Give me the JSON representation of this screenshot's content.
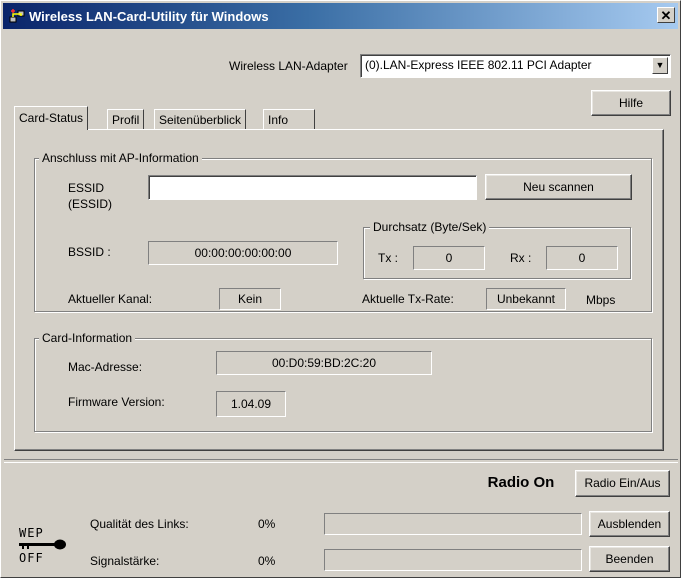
{
  "window": {
    "title": "Wireless LAN-Card-Utility für Windows",
    "close_label": "✕"
  },
  "adapter": {
    "label": "Wireless LAN-Adapter",
    "selected": "(0).LAN-Express IEEE 802.11 PCI Adapter",
    "arrow": "▼"
  },
  "help_button": "Hilfe",
  "tabs": [
    "Card-Status",
    "Profil",
    "Seitenüberblick",
    "Info"
  ],
  "ap_group": {
    "title": "Anschluss mit AP-Information",
    "essid_label": "ESSID\n(ESSID)",
    "essid_value": "",
    "rescan_button": "Neu scannen",
    "bssid_label": "BSSID :",
    "bssid_value": "00:00:00:00:00:00",
    "throughput": {
      "title": "Durchsatz (Byte/Sek)",
      "tx_label": "Tx :",
      "tx_value": "0",
      "rx_label": "Rx :",
      "rx_value": "0"
    },
    "channel_label": "Aktueller Kanal:",
    "channel_value": "Kein",
    "txrate_label": "Aktuelle Tx-Rate:",
    "txrate_value": "Unbekannt",
    "txrate_unit": "Mbps"
  },
  "card_group": {
    "title": "Card-Information",
    "mac_label": "Mac-Adresse:",
    "mac_value": "00:D0:59:BD:2C:20",
    "firmware_label": "Firmware Version:",
    "firmware_value": "1.04.09"
  },
  "radio": {
    "status": "Radio On",
    "toggle_button": "Radio Ein/Aus"
  },
  "wep": {
    "line1": "WEP",
    "line2": "OFF"
  },
  "link_quality": {
    "label": "Qualität des Links:",
    "percent": "0%",
    "level": 0
  },
  "signal": {
    "label": "Signalstärke:",
    "percent": "0%",
    "level": 0
  },
  "buttons": {
    "hide": "Ausblenden",
    "exit": "Beenden"
  }
}
